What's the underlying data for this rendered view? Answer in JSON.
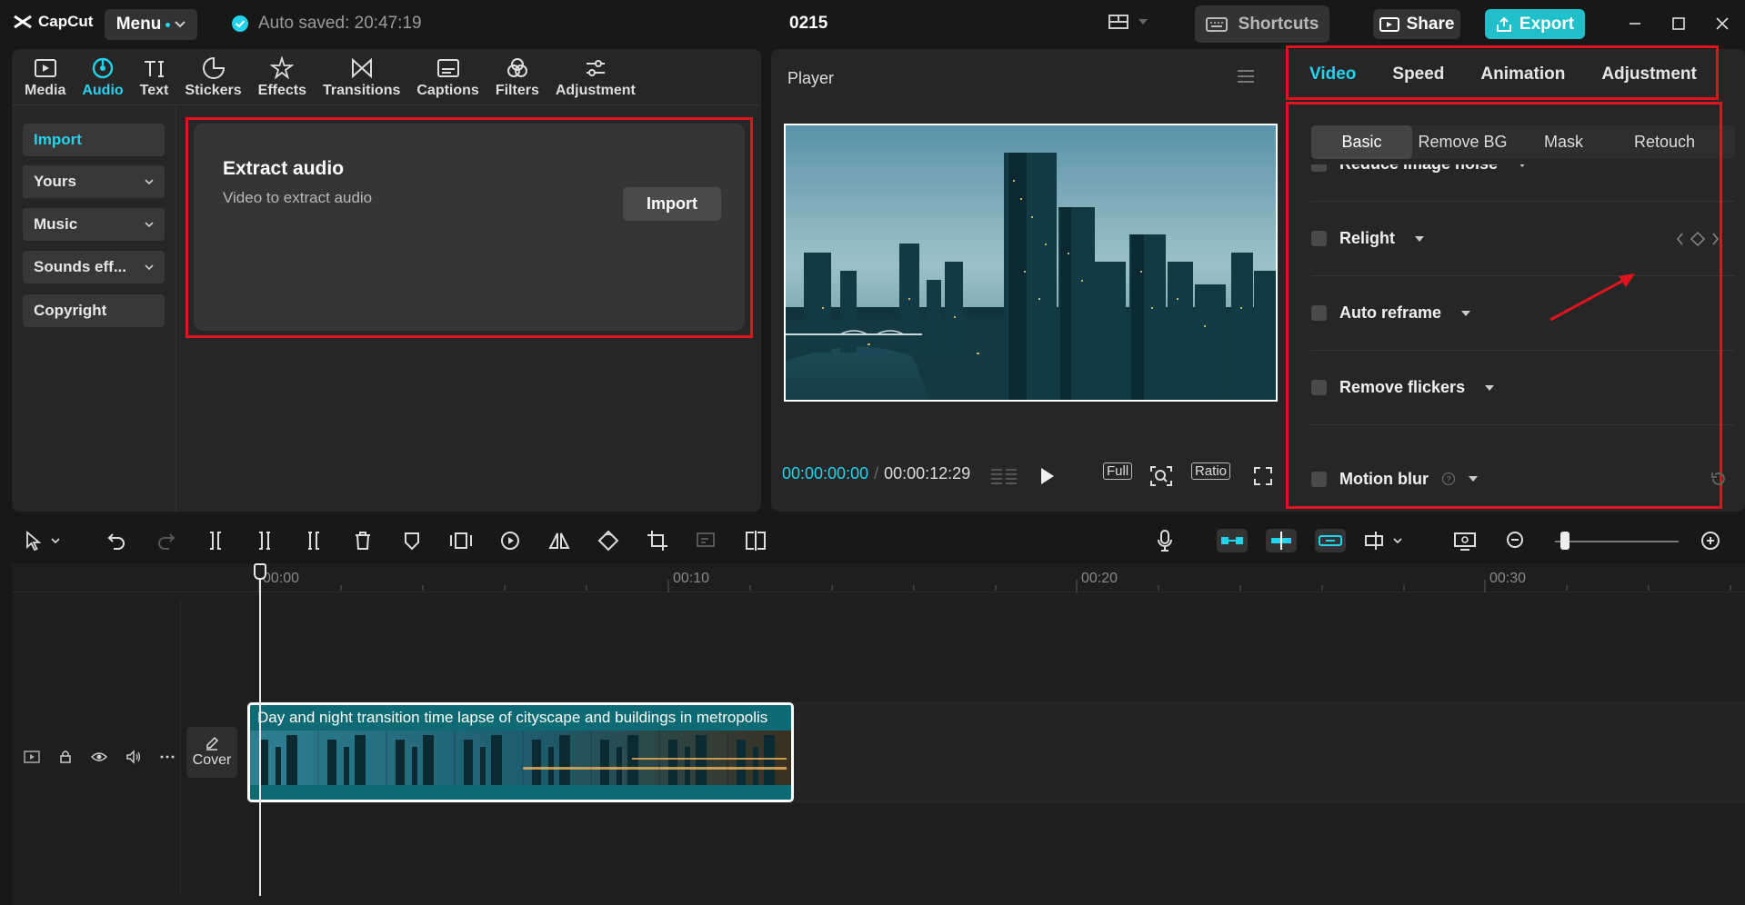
{
  "app": {
    "name": "CapCut",
    "menu_label": "Menu",
    "autosave_text": "Auto saved: 20:47:19",
    "project_title": "0215",
    "shortcuts_label": "Shortcuts",
    "share_label": "Share",
    "export_label": "Export",
    "accent_color": "#22d3ee",
    "export_color": "#20bfc9",
    "highlight_color": "#e0141e"
  },
  "media_tabs": [
    {
      "label": "Media",
      "icon": "media-icon"
    },
    {
      "label": "Audio",
      "icon": "audio-icon",
      "active": true
    },
    {
      "label": "Text",
      "icon": "text-icon"
    },
    {
      "label": "Stickers",
      "icon": "stickers-icon"
    },
    {
      "label": "Effects",
      "icon": "effects-icon"
    },
    {
      "label": "Transitions",
      "icon": "transitions-icon"
    },
    {
      "label": "Captions",
      "icon": "captions-icon"
    },
    {
      "label": "Filters",
      "icon": "filters-icon"
    },
    {
      "label": "Adjustment",
      "icon": "adjustment-icon"
    }
  ],
  "sidebar": {
    "items": [
      {
        "label": "Import",
        "active": true
      },
      {
        "label": "Yours"
      },
      {
        "label": "Music"
      },
      {
        "label": "Sounds eff..."
      },
      {
        "label": "Copyright"
      }
    ]
  },
  "extract": {
    "title": "Extract audio",
    "subtitle": "Video to extract audio",
    "button": "Import"
  },
  "player": {
    "title": "Player",
    "current_time": "00:00:00:00",
    "total_time": "00:00:12:29",
    "full_label": "Full",
    "ratio_label": "Ratio"
  },
  "inspector": {
    "tabs": [
      "Video",
      "Speed",
      "Animation",
      "Adjustment"
    ],
    "active_tab": "Video",
    "subtabs": [
      "Basic",
      "Remove BG",
      "Mask",
      "Retouch"
    ],
    "active_subtab": "Basic",
    "properties": [
      {
        "label": "Reduce image noise"
      },
      {
        "label": "Relight"
      },
      {
        "label": "Auto reframe"
      },
      {
        "label": "Remove flickers"
      },
      {
        "label": "Motion blur"
      }
    ]
  },
  "timeline": {
    "ticks": [
      "00:00",
      "00:10",
      "00:20",
      "00:30"
    ],
    "clip_title": "Day and night transition time lapse of cityscape and buildings in metropolis",
    "cover_label": "Cover"
  }
}
